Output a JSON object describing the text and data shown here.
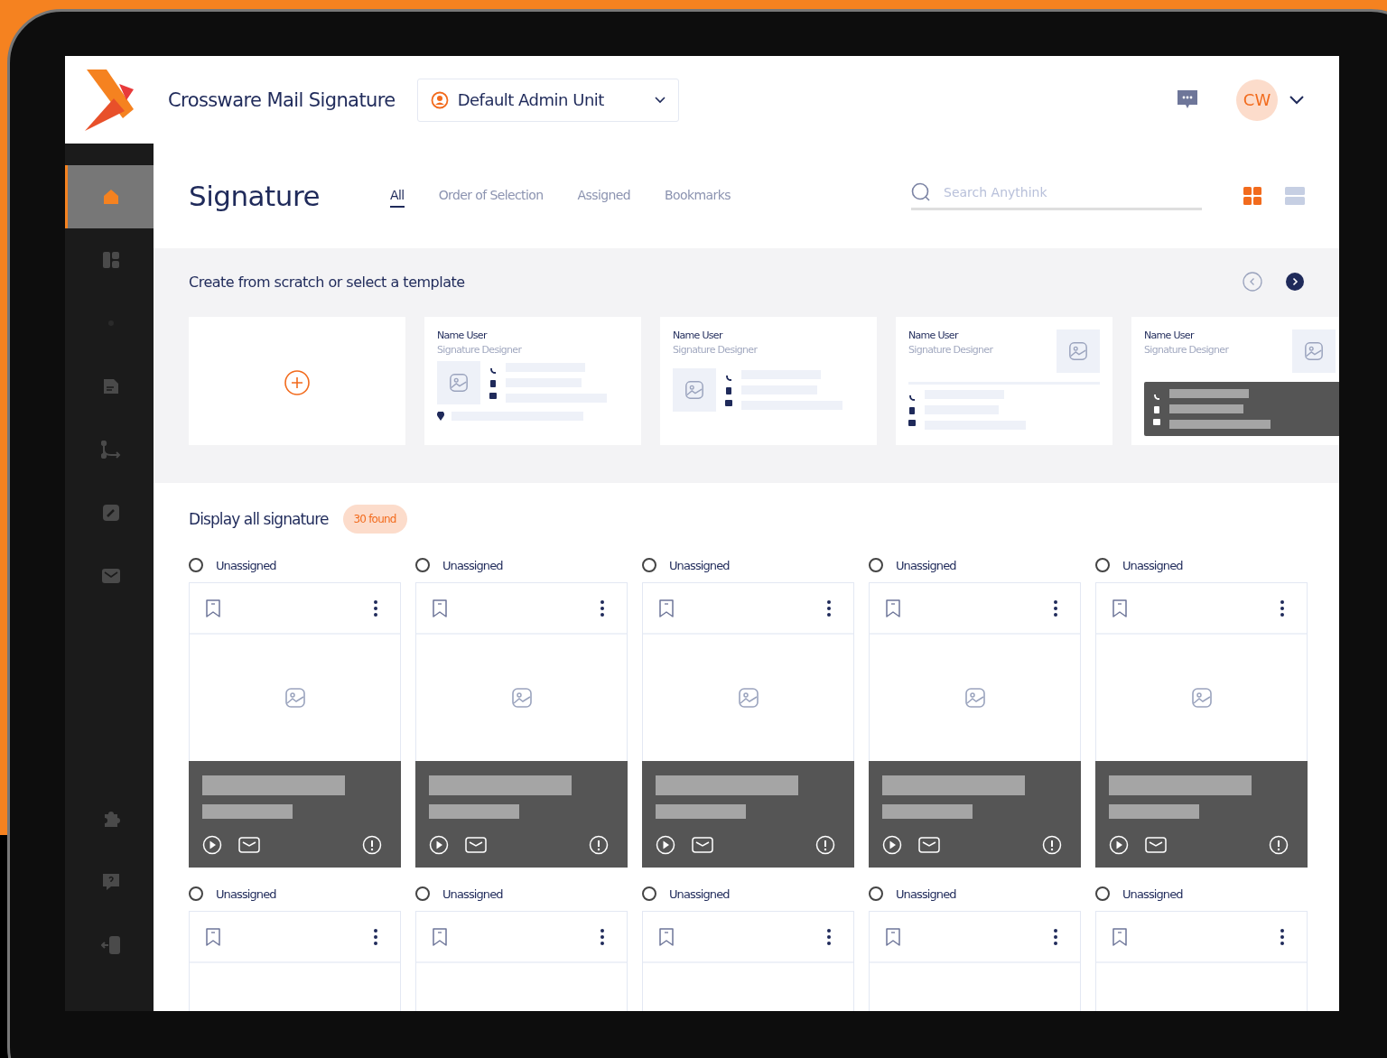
{
  "header": {
    "title": "Crossware Mail Signature",
    "unit_selector": "Default Admin Unit",
    "avatar": "CW"
  },
  "sidebar": {
    "items": [
      {
        "kind": "home",
        "selected": true
      },
      {
        "kind": "dashboard",
        "selected": false
      },
      {
        "kind": "dot",
        "selected": false
      },
      {
        "kind": "document",
        "selected": false
      },
      {
        "kind": "flow",
        "selected": false
      },
      {
        "kind": "edit",
        "selected": false
      },
      {
        "kind": "mail",
        "selected": false
      }
    ],
    "bottom_items": [
      {
        "kind": "puzzle",
        "selected": false
      },
      {
        "kind": "help",
        "selected": false
      },
      {
        "kind": "logout",
        "selected": false
      }
    ]
  },
  "page": {
    "title": "Signature",
    "tabs": [
      {
        "label": "All",
        "selected": true
      },
      {
        "label": "Order of Selection",
        "selected": false
      },
      {
        "label": "Assigned",
        "selected": false
      },
      {
        "label": "Bookmarks",
        "selected": false
      }
    ],
    "search": {
      "placeholder": "Search Anythink"
    },
    "view_toggles": [
      {
        "kind": "grid",
        "selected": true
      },
      {
        "kind": "list",
        "selected": false
      }
    ]
  },
  "templates": {
    "heading": "Create from scratch or select a template",
    "items": [
      {
        "kind": "blank"
      },
      {
        "kind": "photo-left-location",
        "name": "Name User",
        "role": "Signature Designer"
      },
      {
        "kind": "photo-left",
        "name": "Name User",
        "role": "Signature Designer"
      },
      {
        "kind": "photo-right",
        "name": "Name User",
        "role": "Signature Designer"
      },
      {
        "kind": "photo-right-dark",
        "name": "Name User",
        "role": "Signature Designer"
      }
    ]
  },
  "signatures": {
    "heading": "Display all signature",
    "count": "30 found",
    "items": [
      {
        "status": "Unassigned",
        "selected": false
      },
      {
        "status": "Unassigned",
        "selected": false
      },
      {
        "status": "Unassigned",
        "selected": false
      },
      {
        "status": "Unassigned",
        "selected": false
      },
      {
        "status": "Unassigned",
        "selected": false
      },
      {
        "status": "Unassigned",
        "selected": false
      },
      {
        "status": "Unassigned",
        "selected": false
      },
      {
        "status": "Unassigned",
        "selected": false
      },
      {
        "status": "Unassigned",
        "selected": false
      },
      {
        "status": "Unassigned",
        "selected": false
      }
    ]
  }
}
